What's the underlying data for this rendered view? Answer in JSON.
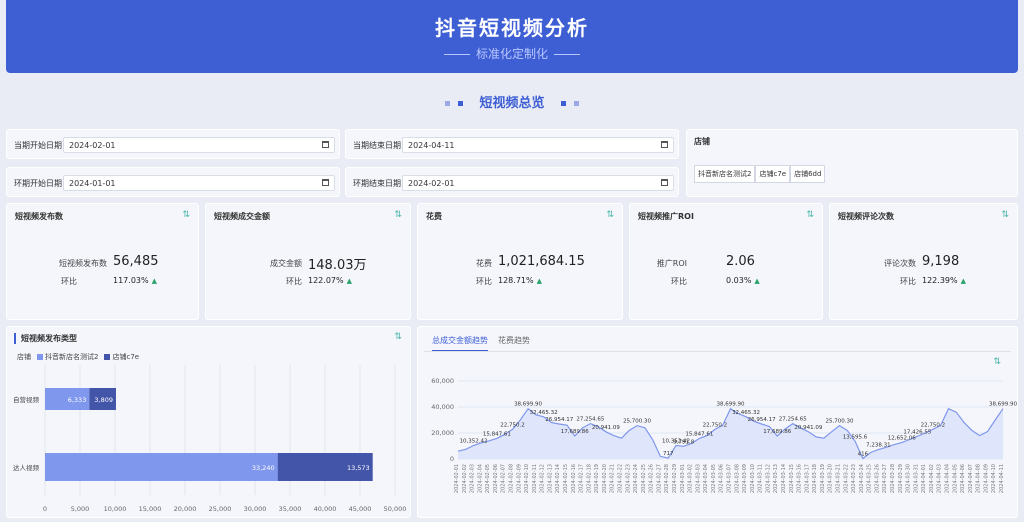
{
  "header": {
    "title": "抖音短视频分析",
    "subtitle": "标准化定制化"
  },
  "section_title": "短视频总览",
  "filters": {
    "current_start": {
      "label": "当期开始日期",
      "value": "2024-02-01"
    },
    "current_end": {
      "label": "当期结束日期",
      "value": "2024-04-11"
    },
    "prev_start": {
      "label": "环期开始日期",
      "value": "2024-01-01"
    },
    "prev_end": {
      "label": "环期结束日期",
      "value": "2024-02-01"
    },
    "store": {
      "label": "店铺",
      "options": [
        "抖音新店名测试2",
        "店铺c7e",
        "店铺6dd"
      ]
    }
  },
  "kpis": [
    {
      "title": "短视频发布数",
      "label": "短视频发布数",
      "value": "56,485",
      "ratio_label": "环比",
      "ratio": "117.03%"
    },
    {
      "title": "短视频成交金额",
      "label": "成交金额",
      "value": "148.03万",
      "ratio_label": "环比",
      "ratio": "122.07%"
    },
    {
      "title": "花费",
      "label": "花费",
      "value": "1,021,684.15",
      "ratio_label": "环比",
      "ratio": "128.71%"
    },
    {
      "title": "短视频推广ROI",
      "label": "推广ROI",
      "value": "2.06",
      "ratio_label": "环比",
      "ratio": "0.03%"
    },
    {
      "title": "短视频评论次数",
      "label": "评论次数",
      "value": "9,198",
      "ratio_label": "环比",
      "ratio": "122.39%"
    }
  ],
  "bar_panel": {
    "title": "短视频发布类型",
    "legend_title": "店铺",
    "chart_data": {
      "type": "bar",
      "orientation": "horizontal",
      "stacked": true,
      "categories": [
        "自营视频",
        "达人视频"
      ],
      "series": [
        {
          "name": "抖音新店名测试2",
          "values": [
            6333,
            33240
          ]
        },
        {
          "name": "店铺c7e",
          "values": [
            3809,
            13573
          ]
        }
      ],
      "xlim": [
        0,
        50000
      ],
      "xticks": [
        0,
        5000,
        10000,
        15000,
        20000,
        25000,
        30000,
        35000,
        40000,
        45000,
        50000
      ],
      "xtick_labels": [
        "0",
        "5,000",
        "10,000",
        "15,000",
        "20,000",
        "25,000",
        "30,000",
        "35,000",
        "40,000",
        "45,000",
        "50,000"
      ],
      "value_labels": [
        [
          "6,333",
          "3,809"
        ],
        [
          "33,240",
          "13,573"
        ]
      ],
      "colors": [
        "#7f97ec",
        "#4355a8"
      ],
      "grid": true
    }
  },
  "line_panel": {
    "tabs": [
      "总成交金额趋势",
      "花费趋势"
    ],
    "chart_data": {
      "type": "area",
      "ylim": [
        0,
        60000
      ],
      "yticks": [
        0,
        20000,
        40000,
        60000
      ],
      "ytick_labels": [
        "0",
        "20,000",
        "40,000",
        "60,000"
      ],
      "x": [
        "2024-02-01",
        "2024-02-02",
        "2024-02-03",
        "2024-02-04",
        "2024-02-05",
        "2024-02-06",
        "2024-02-07",
        "2024-02-08",
        "2024-02-09",
        "2024-02-10",
        "2024-02-11",
        "2024-02-12",
        "2024-02-13",
        "2024-02-14",
        "2024-02-15",
        "2024-02-16",
        "2024-02-17",
        "2024-02-18",
        "2024-02-19",
        "2024-02-20",
        "2024-02-21",
        "2024-02-22",
        "2024-02-23",
        "2024-02-24",
        "2024-02-25",
        "2024-02-26",
        "2024-02-27",
        "2024-02-28",
        "2024-02-29",
        "2024-03-01",
        "2024-03-02",
        "2024-03-03",
        "2024-03-04",
        "2024-03-05",
        "2024-03-06",
        "2024-03-07",
        "2024-03-08",
        "2024-03-09",
        "2024-03-10",
        "2024-03-11",
        "2024-03-12",
        "2024-03-13",
        "2024-03-14",
        "2024-03-15",
        "2024-03-16",
        "2024-03-17",
        "2024-03-18",
        "2024-03-19",
        "2024-03-20",
        "2024-03-21",
        "2024-03-22",
        "2024-03-23",
        "2024-03-24",
        "2024-03-25",
        "2024-03-26",
        "2024-03-27",
        "2024-03-28",
        "2024-03-29",
        "2024-03-30",
        "2024-03-31",
        "2024-04-01",
        "2024-04-02",
        "2024-04-03",
        "2024-04-04",
        "2024-04-05",
        "2024-04-06",
        "2024-04-07",
        "2024-04-08",
        "2024-04-09",
        "2024-04-10",
        "2024-04-11"
      ],
      "values": [
        6000,
        7500,
        10352.42,
        12500,
        14000,
        15847.61,
        19000,
        22750.2,
        30000,
        38699.9,
        34000,
        32465.32,
        28000,
        26954.17,
        26000,
        17689.86,
        24000,
        27254.65,
        25000,
        20941.09,
        18000,
        16000,
        22000,
        25700.3,
        24000,
        15000,
        2000,
        717,
        10352.42,
        9791.8,
        12000,
        15847.61,
        18000,
        22750.2,
        26000,
        38699.9,
        35000,
        32465.32,
        29000,
        26954.17,
        25000,
        17689.86,
        23000,
        27254.65,
        24000,
        20941.09,
        17000,
        16000,
        21000,
        25700.3,
        22000,
        13595.6,
        416,
        5000,
        7238.31,
        9000,
        11000,
        12652.06,
        15000,
        17426.55,
        20000,
        22750.2,
        26000,
        38699.9,
        36000,
        28000,
        22000,
        18000,
        21000,
        30000,
        38699.9
      ],
      "labels": [
        {
          "i": 2,
          "text": "10,352.42"
        },
        {
          "i": 5,
          "text": "15,847.61"
        },
        {
          "i": 7,
          "text": "22,750.2"
        },
        {
          "i": 9,
          "text": "38,699.90"
        },
        {
          "i": 11,
          "text": "32,465.32"
        },
        {
          "i": 13,
          "text": "26,954.17"
        },
        {
          "i": 15,
          "text": "17,689.86"
        },
        {
          "i": 17,
          "text": "27,254.65"
        },
        {
          "i": 19,
          "text": "20,941.09"
        },
        {
          "i": 23,
          "text": "25,700.30"
        },
        {
          "i": 27,
          "text": "717"
        },
        {
          "i": 28,
          "text": "10,352.42"
        },
        {
          "i": 29,
          "text": "9,791.8"
        },
        {
          "i": 31,
          "text": "15,847.61"
        },
        {
          "i": 33,
          "text": "22,750.2"
        },
        {
          "i": 35,
          "text": "38,699.90"
        },
        {
          "i": 37,
          "text": "32,465.32"
        },
        {
          "i": 39,
          "text": "26,954.17"
        },
        {
          "i": 41,
          "text": "17,689.86"
        },
        {
          "i": 43,
          "text": "27,254.65"
        },
        {
          "i": 45,
          "text": "20,941.09"
        },
        {
          "i": 49,
          "text": "25,700.30"
        },
        {
          "i": 51,
          "text": "13,595.6"
        },
        {
          "i": 52,
          "text": "416"
        },
        {
          "i": 54,
          "text": "7,238.31"
        },
        {
          "i": 57,
          "text": "12,652.06"
        },
        {
          "i": 59,
          "text": "17,426.55"
        },
        {
          "i": 61,
          "text": "22,750.2"
        },
        {
          "i": 70,
          "text": "38,699.90"
        }
      ],
      "color": "#7f97ec",
      "fill": "#dfe5fb",
      "grid": true
    }
  },
  "colors": {
    "primary": "#3e5fd4",
    "up": "#2aa46b",
    "icon": "#4bb5a8"
  }
}
